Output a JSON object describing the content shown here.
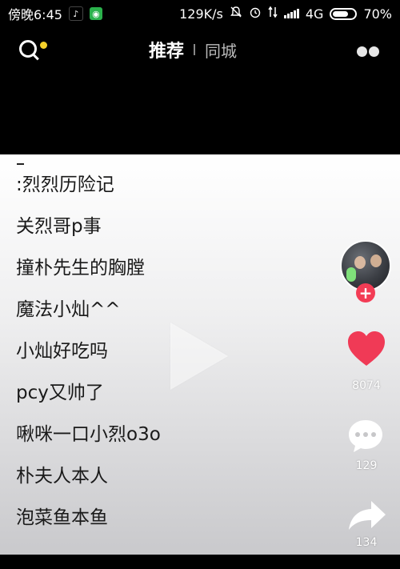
{
  "status_bar": {
    "time": "傍晚6:45",
    "network_speed": "129K/s",
    "network_type": "4G",
    "battery_percent": "70%",
    "battery_level": 0.7,
    "tiktok_icon_glyph": "♪",
    "app_icon_glyph": "◉"
  },
  "nav": {
    "tab_recommend": "推荐",
    "tab_local": "同城",
    "accent_dot_color": "#f5d12a"
  },
  "video": {
    "dash": "-",
    "list_items": [
      ":烈烈历险记",
      "关烈哥p事",
      "撞朴先生的胸膛",
      "魔法小灿^^",
      "小灿好吃吗",
      "pcy又帅了",
      "啾咪一口小烈o3o",
      "朴夫人本人",
      "泡菜鱼本鱼"
    ]
  },
  "actions": {
    "follow_symbol": "+",
    "like_count": "8074",
    "comment_count": "129",
    "share_count": "134",
    "like_color": "#f03a56",
    "follow_color": "#f33c55"
  }
}
